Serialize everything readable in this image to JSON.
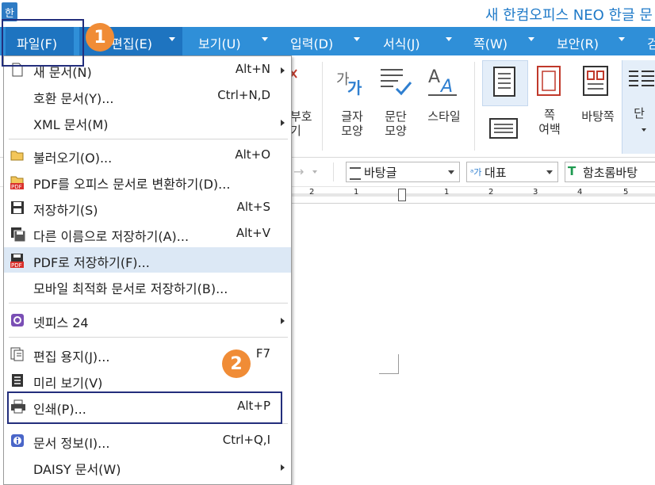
{
  "app": {
    "icon_char": "한",
    "title": "새 한컴오피스 NEO 한글 문"
  },
  "menubar": {
    "file": "파일(F)",
    "edit": "편집(E)",
    "view": "보기(U)",
    "input": "입력(D)",
    "format": "서식(J)",
    "page": "쪽(W)",
    "security": "보안(R)",
    "more": "검"
  },
  "ribbon": {
    "symbol": "부호\n기",
    "char_shape": "글자\n모양",
    "para_shape": "문단\n모양",
    "style": "스타일",
    "page_margin": "쪽\n여백",
    "background": "바탕쪽",
    "column": "단"
  },
  "toolbar": {
    "style_combo": "바탕글",
    "lang_combo": "대표",
    "font_combo": "함초롬바탕"
  },
  "ruler": {
    "marks": [
      "2",
      "1",
      "1",
      "2",
      "3",
      "4",
      "5"
    ]
  },
  "file_menu": {
    "items": [
      {
        "label": "새 문서(N)",
        "shortcut": "Alt+N",
        "submenu": true
      },
      {
        "label": "호환 문서(Y)...",
        "shortcut": "Ctrl+N,D",
        "submenu": false
      },
      {
        "label": "XML 문서(M)",
        "shortcut": "",
        "submenu": true
      },
      {
        "label": "불러오기(O)...",
        "shortcut": "Alt+O",
        "submenu": false
      },
      {
        "label": "PDF를 오피스 문서로 변환하기(D)...",
        "shortcut": "",
        "submenu": false
      },
      {
        "label": "저장하기(S)",
        "shortcut": "Alt+S",
        "submenu": false
      },
      {
        "label": "다른 이름으로 저장하기(A)...",
        "shortcut": "Alt+V",
        "submenu": false
      },
      {
        "label": "PDF로 저장하기(F)...",
        "shortcut": "",
        "submenu": false
      },
      {
        "label": "모바일 최적화 문서로 저장하기(B)...",
        "shortcut": "",
        "submenu": false
      },
      {
        "label": "넷피스 24",
        "shortcut": "",
        "submenu": true
      },
      {
        "label": "편집 용지(J)...",
        "shortcut": "F7",
        "submenu": false
      },
      {
        "label": "미리 보기(V)",
        "shortcut": "",
        "submenu": false
      },
      {
        "label": "인쇄(P)...",
        "shortcut": "Alt+P",
        "submenu": false
      },
      {
        "label": "문서 정보(I)...",
        "shortcut": "Ctrl+Q,I",
        "submenu": false
      },
      {
        "label": "DAISY 문서(W)",
        "shortcut": "",
        "submenu": true
      }
    ]
  },
  "annotations": {
    "step1": "1",
    "step2": "2"
  },
  "colors": {
    "menubar": "#2f8fd8",
    "active_tab": "#1e74c0",
    "highlight": "#dce8f5",
    "badge": "#f08c36",
    "box": "#232e7c"
  }
}
